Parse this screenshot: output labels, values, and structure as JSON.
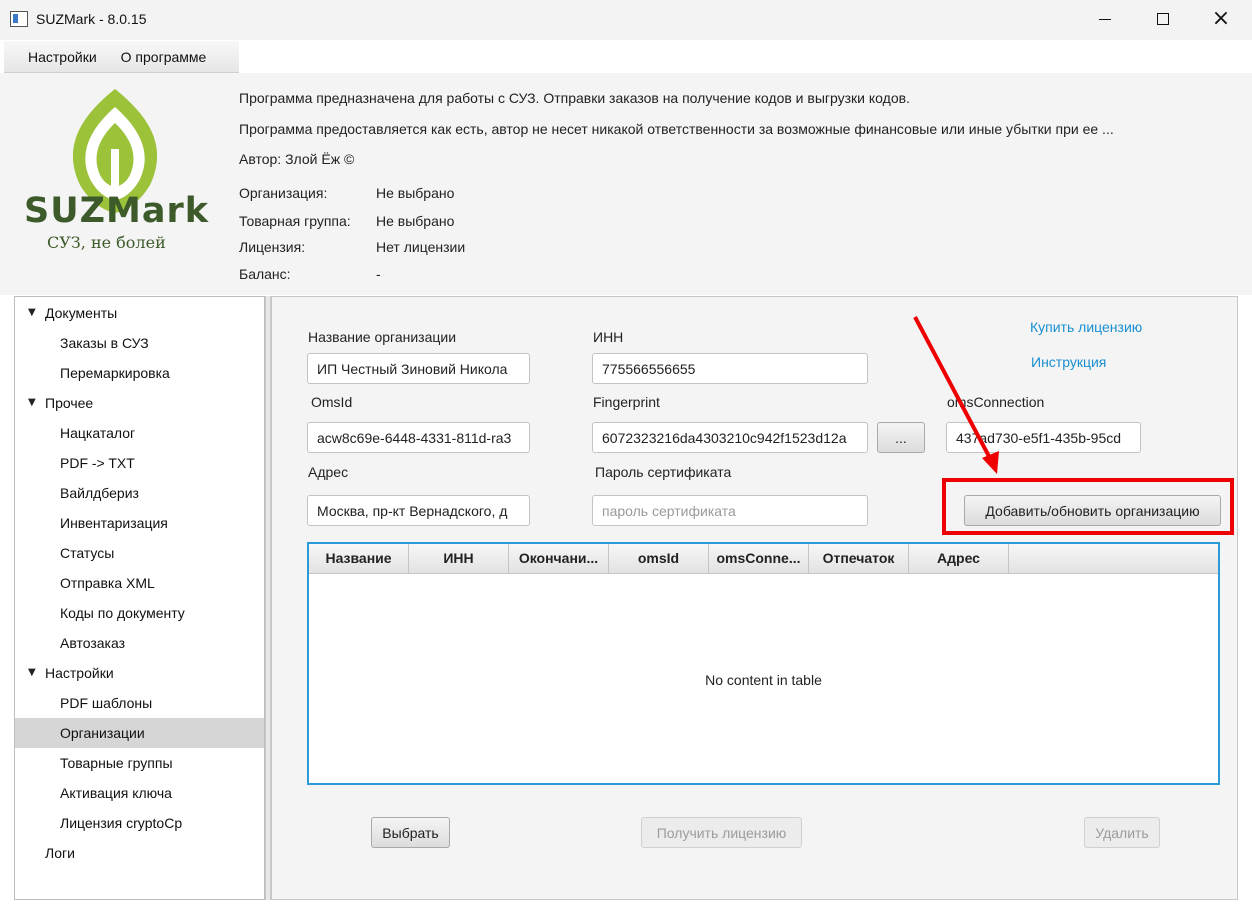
{
  "window": {
    "title": "SUZMark - 8.0.15"
  },
  "menu": {
    "items": [
      "Настройки",
      "О программе"
    ]
  },
  "logo": {
    "name": "SUZMark",
    "slogan": "СУЗ, не болей",
    "colors": {
      "green_light": "#9cc23a",
      "green_dark": "#3d5a2a"
    }
  },
  "header": {
    "description_1": "Программа предназначена для работы с СУЗ. Отправки заказов на получение кодов и выгрузки кодов.",
    "description_2": "Программа предоставляется как есть, автор не несет никакой ответственности за возможные финансовые или иные убытки при ее ...",
    "author": "Автор: Злой Ёж ©",
    "info": [
      {
        "label": "Организация:",
        "value": "Не выбрано"
      },
      {
        "label": "Товарная группа:",
        "value": "Не выбрано"
      },
      {
        "label": "Лицензия:",
        "value": "Нет лицензии"
      },
      {
        "label": "Баланс:",
        "value": "-"
      }
    ]
  },
  "nav": {
    "items": [
      {
        "label": "Документы",
        "level": 0,
        "expanded": true
      },
      {
        "label": "Заказы в СУЗ",
        "level": 1
      },
      {
        "label": "Перемаркировка",
        "level": 1
      },
      {
        "label": "Прочее",
        "level": 0,
        "expanded": true
      },
      {
        "label": "Нацкаталог",
        "level": 1
      },
      {
        "label": "PDF -> TXT",
        "level": 1
      },
      {
        "label": "Вайлдбериз",
        "level": 1
      },
      {
        "label": "Инвентаризация",
        "level": 1
      },
      {
        "label": "Статусы",
        "level": 1
      },
      {
        "label": "Отправка XML",
        "level": 1
      },
      {
        "label": "Коды по документу",
        "level": 1
      },
      {
        "label": "Автозаказ",
        "level": 1
      },
      {
        "label": "Настройки",
        "level": 0,
        "expanded": true
      },
      {
        "label": "PDF шаблоны",
        "level": 1
      },
      {
        "label": "Организации",
        "level": 1,
        "selected": true
      },
      {
        "label": "Товарные группы",
        "level": 1
      },
      {
        "label": "Активация ключа",
        "level": 1
      },
      {
        "label": "Лицензия cryptoCp",
        "level": 1
      },
      {
        "label": "Логи",
        "level": 0
      }
    ]
  },
  "form": {
    "org_name_label": "Название организации",
    "org_name_value": "ИП Честный Зиновий Никола",
    "inn_label": "ИНН",
    "inn_value": "775566556655",
    "oms_id_label": "OmsId",
    "oms_id_value": "acw8c69e-6448-4331-811d-ra3",
    "fingerprint_label": "Fingerprint",
    "fingerprint_value": "6072323216da4303210c942f1523d12a",
    "browse_label": "...",
    "oms_connection_label": "omsConnection",
    "oms_connection_value": "437ad730-e5f1-435b-95cd",
    "address_label": "Адрес",
    "address_value": "Москва, пр-кт Вернадского, д",
    "cert_password_label": "Пароль сертификата",
    "cert_password_placeholder": "пароль сертификата",
    "buy_license_link": "Купить лицензию",
    "instruction_link": "Инструкция",
    "add_update_button": "Добавить/обновить организацию"
  },
  "table": {
    "columns": [
      "Название",
      "ИНН",
      "Окончани...",
      "omsId",
      "omsConne...",
      "Отпечаток",
      "Адрес"
    ],
    "rows": [],
    "empty_text": "No content in table",
    "border_color": "#2a9bd8"
  },
  "actions": {
    "select_button": "Выбрать",
    "get_license_button": "Получить лицензию",
    "delete_button": "Удалить"
  },
  "annotations": {
    "color": "#ee0000"
  }
}
